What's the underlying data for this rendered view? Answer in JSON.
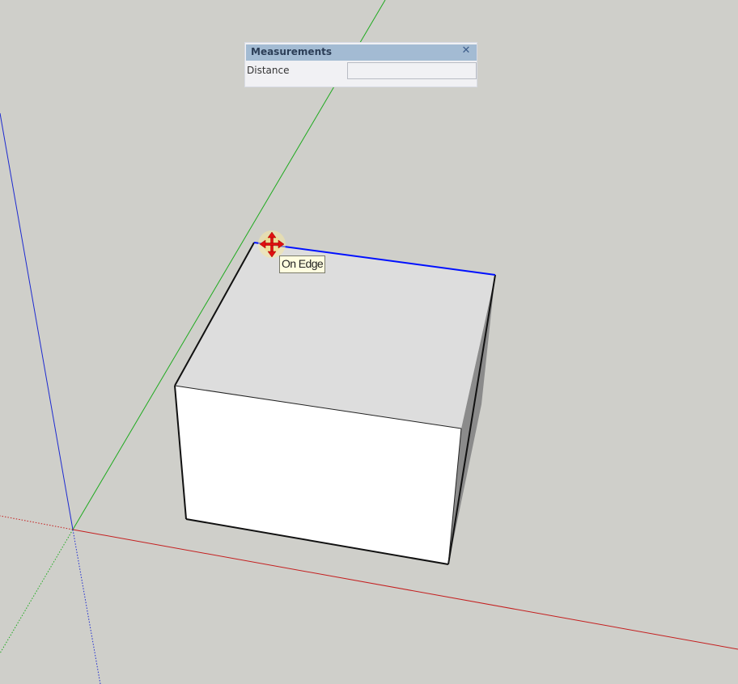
{
  "measurements": {
    "title": "Measurements",
    "close_label": "✕",
    "field_label": "Distance",
    "field_value": ""
  },
  "tooltip": {
    "text": "On Edge"
  },
  "cursor": {
    "icon": "move-arrows-icon"
  },
  "colors": {
    "background": "#cfcfca",
    "red_axis": "#cc2222",
    "green_axis": "#22aa22",
    "blue_axis": "#2233cc",
    "highlight_edge": "#0010ff",
    "panel_title": "#a3bbd3"
  }
}
